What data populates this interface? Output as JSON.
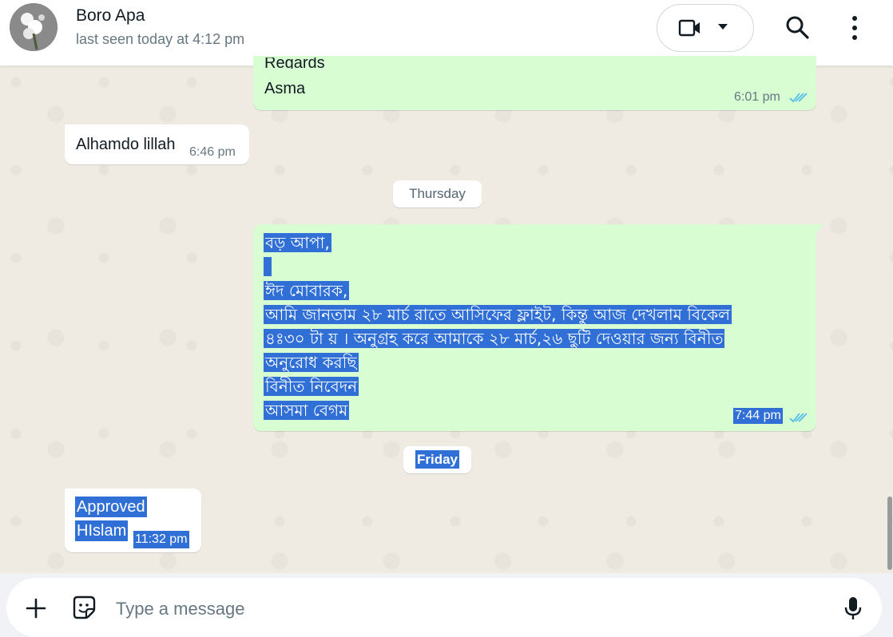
{
  "header": {
    "contact_name": "Boro Apa",
    "last_seen": "last seen today at 4:12 pm"
  },
  "messages": [
    {
      "direction": "out",
      "partial_line": "Regards",
      "text": "Asma",
      "time": "6:01 pm",
      "status": "read"
    },
    {
      "direction": "in",
      "text": "Alhamdo lillah",
      "time": "6:46 pm"
    },
    {
      "direction": "out",
      "lines": [
        "বড় আপা,",
        "",
        "ঈদ মোবারক,",
        "আমি জানতাম ২৮ মার্চ রাতে আসিফের ফ্লাইট, কিন্তু আজ দেখলাম বিকেল",
        "৪ঃ৩০ টা য় । অনুগ্রহ করে আমাকে ২৮ মার্চ,২৬ ছুটি দেওয়ার জন্য বিনীত",
        "অনুরোধ করছি",
        "বিনীত নিবেদন",
        "আসমা বেগম"
      ],
      "time": "7:44 pm",
      "status": "read",
      "selected": true
    },
    {
      "direction": "in",
      "lines": [
        "Approved",
        "HIslam"
      ],
      "time": "11:32 pm",
      "selected": true
    }
  ],
  "day_dividers": [
    "Thursday",
    "Friday"
  ],
  "composer": {
    "placeholder": "Type a message",
    "value": ""
  },
  "colors": {
    "outgoing_bubble": "#d9fdd3",
    "incoming_bubble": "#ffffff",
    "selection": "#2f6fd6",
    "read_ticks": "#53bdeb",
    "chat_background": "#efeae2"
  },
  "icons": [
    "video-camera-icon",
    "chevron-down-icon",
    "search-icon",
    "more-vertical-icon",
    "plus-icon",
    "sticker-icon",
    "microphone-icon",
    "double-check-icon"
  ]
}
